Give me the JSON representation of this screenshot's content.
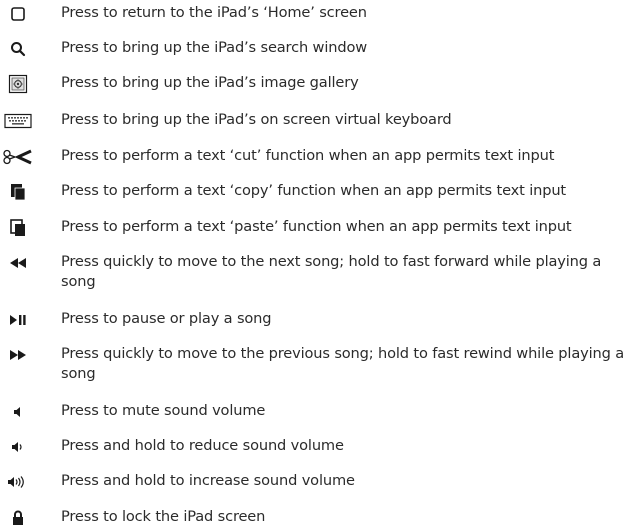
{
  "rows": [
    {
      "icon": "home-icon",
      "text": "Press to return to the iPad’s ‘Home’ screen"
    },
    {
      "icon": "search-icon",
      "text": "Press to bring up the iPad’s search window"
    },
    {
      "icon": "image-gallery-icon",
      "text": "Press to bring up the iPad’s image gallery"
    },
    {
      "icon": "keyboard-icon",
      "text": "Press to bring up the iPad’s on screen virtual keyboard"
    },
    {
      "icon": "scissors-icon",
      "text": "Press to perform a text ‘cut’ function when an app permits text input"
    },
    {
      "icon": "copy-icon",
      "text": "Press to perform a text ‘copy’ function when an app permits text input"
    },
    {
      "icon": "paste-icon",
      "text": "Press to perform a text ‘paste’ function when an app permits text input"
    },
    {
      "icon": "rewind-icon",
      "text": "Press quickly to move to the next song; hold to fast forward while playing a song"
    },
    {
      "icon": "play-pause-icon",
      "text": "Press to pause or play a song"
    },
    {
      "icon": "fast-forward-icon",
      "text": "Press quickly to move to the previous song; hold to fast rewind while playing a song"
    },
    {
      "icon": "mute-icon",
      "text": "Press to mute sound volume"
    },
    {
      "icon": "volume-down-icon",
      "text": "Press and hold to reduce sound volume"
    },
    {
      "icon": "volume-up-icon",
      "text": "Press and hold to increase sound volume"
    },
    {
      "icon": "lock-icon",
      "text": "Press to lock the iPad screen"
    }
  ]
}
